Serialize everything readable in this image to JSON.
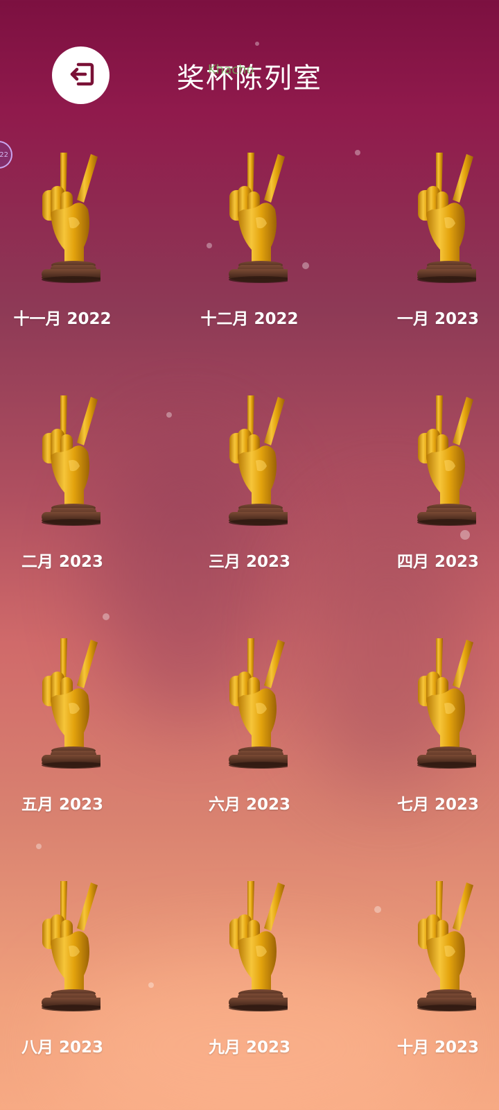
{
  "header": {
    "title": "奖杯陈列室",
    "overlay_text": "Khacho",
    "back_icon": "exit-icon"
  },
  "side_badge": {
    "text": "22"
  },
  "colors": {
    "bg_top": "#7c1040",
    "bg_bottom": "#f7aa84",
    "trophy_gold": "#e0a40c",
    "trophy_base": "#5a3526"
  },
  "trophies": [
    {
      "label": "十一月 2022",
      "icon": "trophy-peace-hand-icon"
    },
    {
      "label": "十二月 2022",
      "icon": "trophy-peace-hand-icon"
    },
    {
      "label": "一月 2023",
      "icon": "trophy-peace-hand-icon"
    },
    {
      "label": "二月 2023",
      "icon": "trophy-peace-hand-icon"
    },
    {
      "label": "三月 2023",
      "icon": "trophy-peace-hand-icon"
    },
    {
      "label": "四月 2023",
      "icon": "trophy-peace-hand-icon"
    },
    {
      "label": "五月 2023",
      "icon": "trophy-peace-hand-icon"
    },
    {
      "label": "六月 2023",
      "icon": "trophy-peace-hand-icon"
    },
    {
      "label": "七月 2023",
      "icon": "trophy-peace-hand-icon"
    },
    {
      "label": "八月 2023",
      "icon": "trophy-peace-hand-icon"
    },
    {
      "label": "九月 2023",
      "icon": "trophy-peace-hand-icon"
    },
    {
      "label": "十月 2023",
      "icon": "trophy-peace-hand-icon"
    }
  ]
}
